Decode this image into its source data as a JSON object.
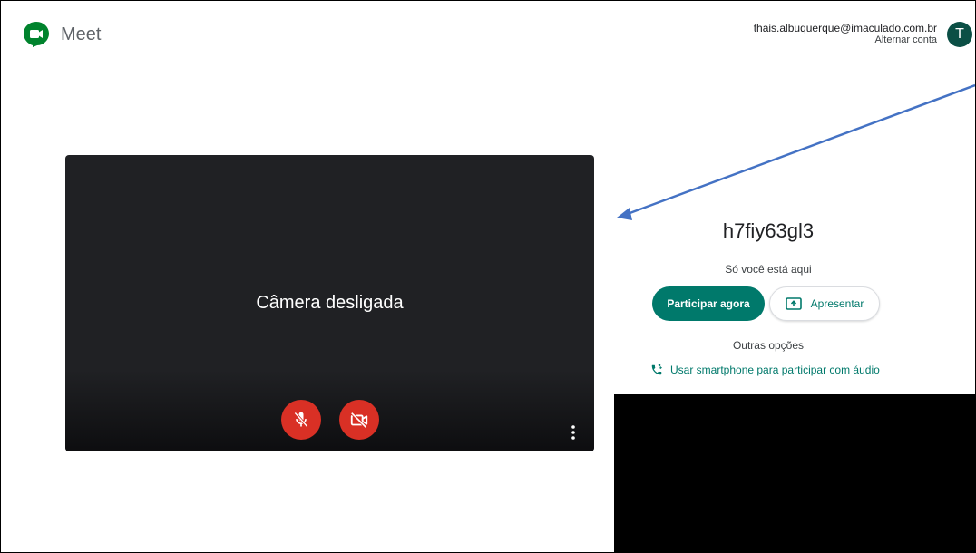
{
  "app": {
    "name": "Meet"
  },
  "account": {
    "email": "thais.albuquerque@imaculado.com.br",
    "switch_label": "Alternar conta",
    "avatar_letter": "T"
  },
  "preview": {
    "status_text": "Câmera desligada"
  },
  "join": {
    "meeting_code": "h7fiy63gl3",
    "alone_text": "Só você está aqui",
    "join_label": "Participar agora",
    "present_label": "Apresentar",
    "other_options_label": "Outras opções",
    "phone_audio_label": "Usar smartphone para participar com áudio"
  },
  "colors": {
    "accent": "#00796b",
    "danger": "#d93025",
    "preview_bg": "#202124",
    "annotation_arrow": "#4472c4"
  },
  "icons": [
    "meet-logo-icon",
    "mic-off-icon",
    "camera-off-icon",
    "more-vert-icon",
    "present-icon",
    "phone-icon"
  ]
}
